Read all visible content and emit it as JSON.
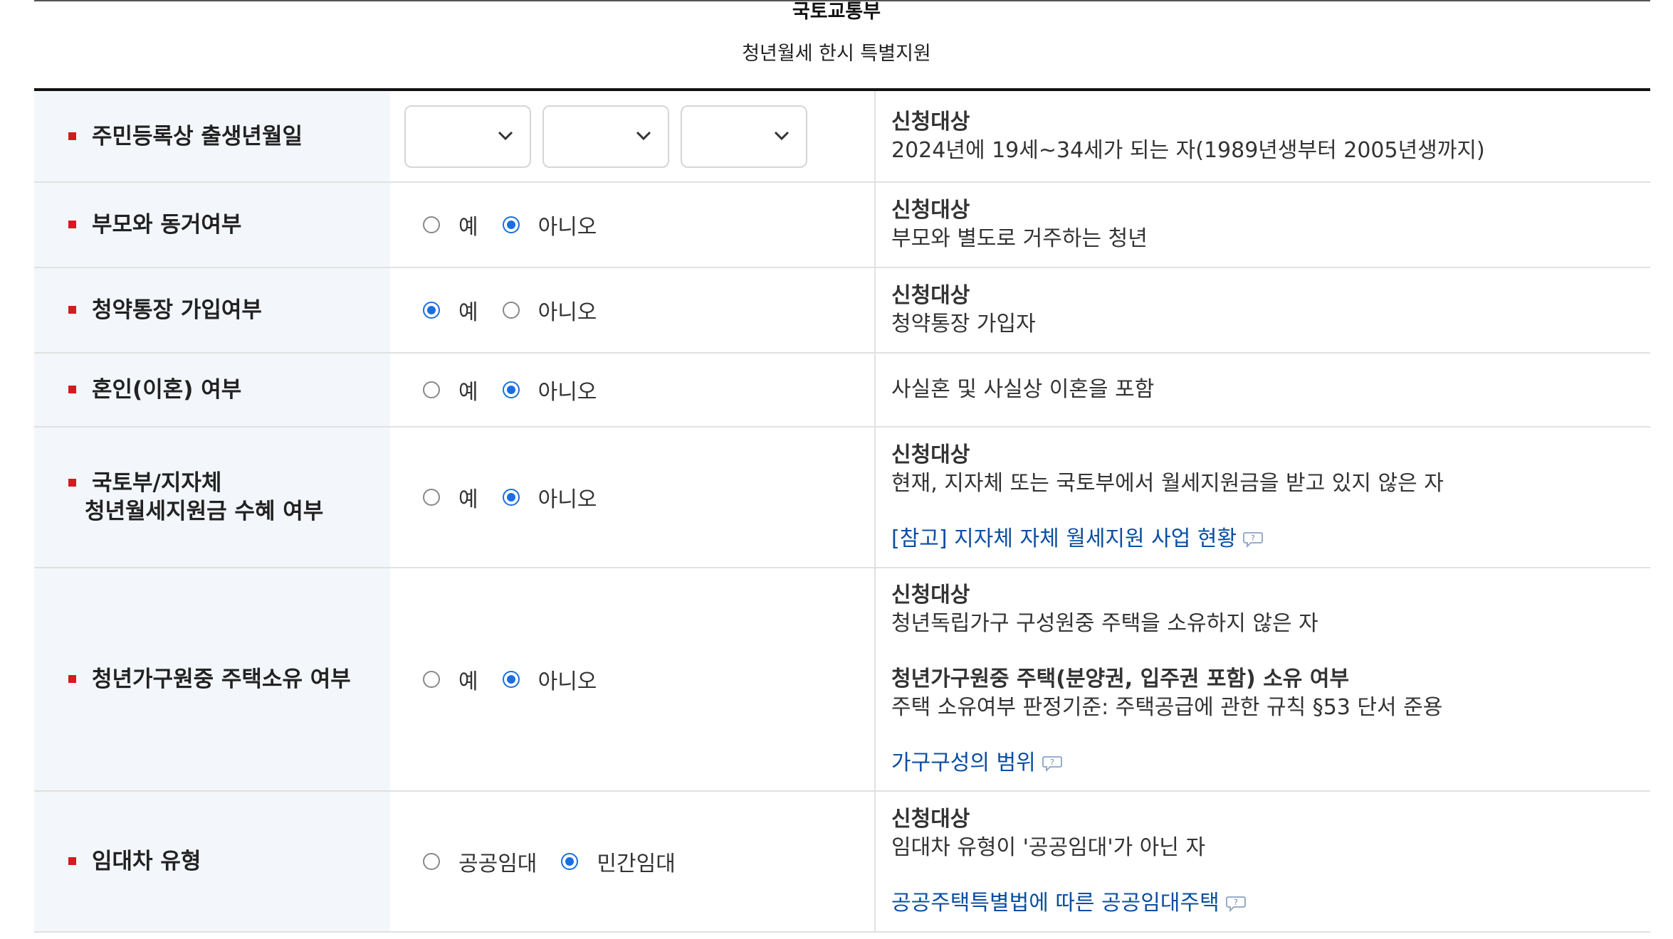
{
  "header": {
    "agency": "국토교통부",
    "program": "청년월세 한시 특별지원"
  },
  "rows": [
    {
      "label": "주민등록상 출생년월일",
      "selects": [
        "",
        "",
        ""
      ],
      "desc": {
        "title": "신청대상",
        "line": "2024년에 19세~34세가 되는 자(1989년생부터 2005년생까지)"
      }
    },
    {
      "label": "부모와 동거여부",
      "options": [
        "예",
        "아니오"
      ],
      "selected": "아니오",
      "desc": {
        "title": "신청대상",
        "line": "부모와 별도로 거주하는 청년"
      }
    },
    {
      "label": "청약통장 가입여부",
      "options": [
        "예",
        "아니오"
      ],
      "selected": "예",
      "desc": {
        "title": "신청대상",
        "line": "청약통장 가입자"
      }
    },
    {
      "label": "혼인(이혼) 여부",
      "options": [
        "예",
        "아니오"
      ],
      "selected": "아니오",
      "desc": {
        "line": "사실혼 및 사실상 이혼을 포함"
      }
    },
    {
      "label_lines": [
        "국토부/지자체",
        "청년월세지원금 수혜 여부"
      ],
      "options": [
        "예",
        "아니오"
      ],
      "selected": "아니오",
      "desc": {
        "title": "신청대상",
        "line": "현재, 지자체 또는 국토부에서 월세지원금을 받고 있지 않은 자",
        "link": "[참고] 지자체 자체 월세지원 사업 현황"
      }
    },
    {
      "label": "청년가구원중 주택소유 여부",
      "options": [
        "예",
        "아니오"
      ],
      "selected": "아니오",
      "desc": {
        "title": "신청대상",
        "line": "청년독립가구 구성원중 주택을 소유하지 않은 자",
        "title2": "청년가구원중 주택(분양권, 입주권 포함) 소유 여부",
        "line2": "주택 소유여부 판정기준: 주택공급에 관한 규칙 §53 단서 준용",
        "link": "가구구성의 범위"
      }
    },
    {
      "label": "임대차 유형",
      "options": [
        "공공임대",
        "민간임대"
      ],
      "selected": "민간임대",
      "desc": {
        "title": "신청대상",
        "line": "임대차 유형이 '공공임대'가 아닌 자",
        "link": "공공주택특별법에 따른 공공임대주택"
      }
    }
  ],
  "colors": {
    "accent": "#1a6fe0",
    "bullet": "#d71920",
    "link": "#0b4ea2",
    "label_bg": "#f3f6fa"
  }
}
